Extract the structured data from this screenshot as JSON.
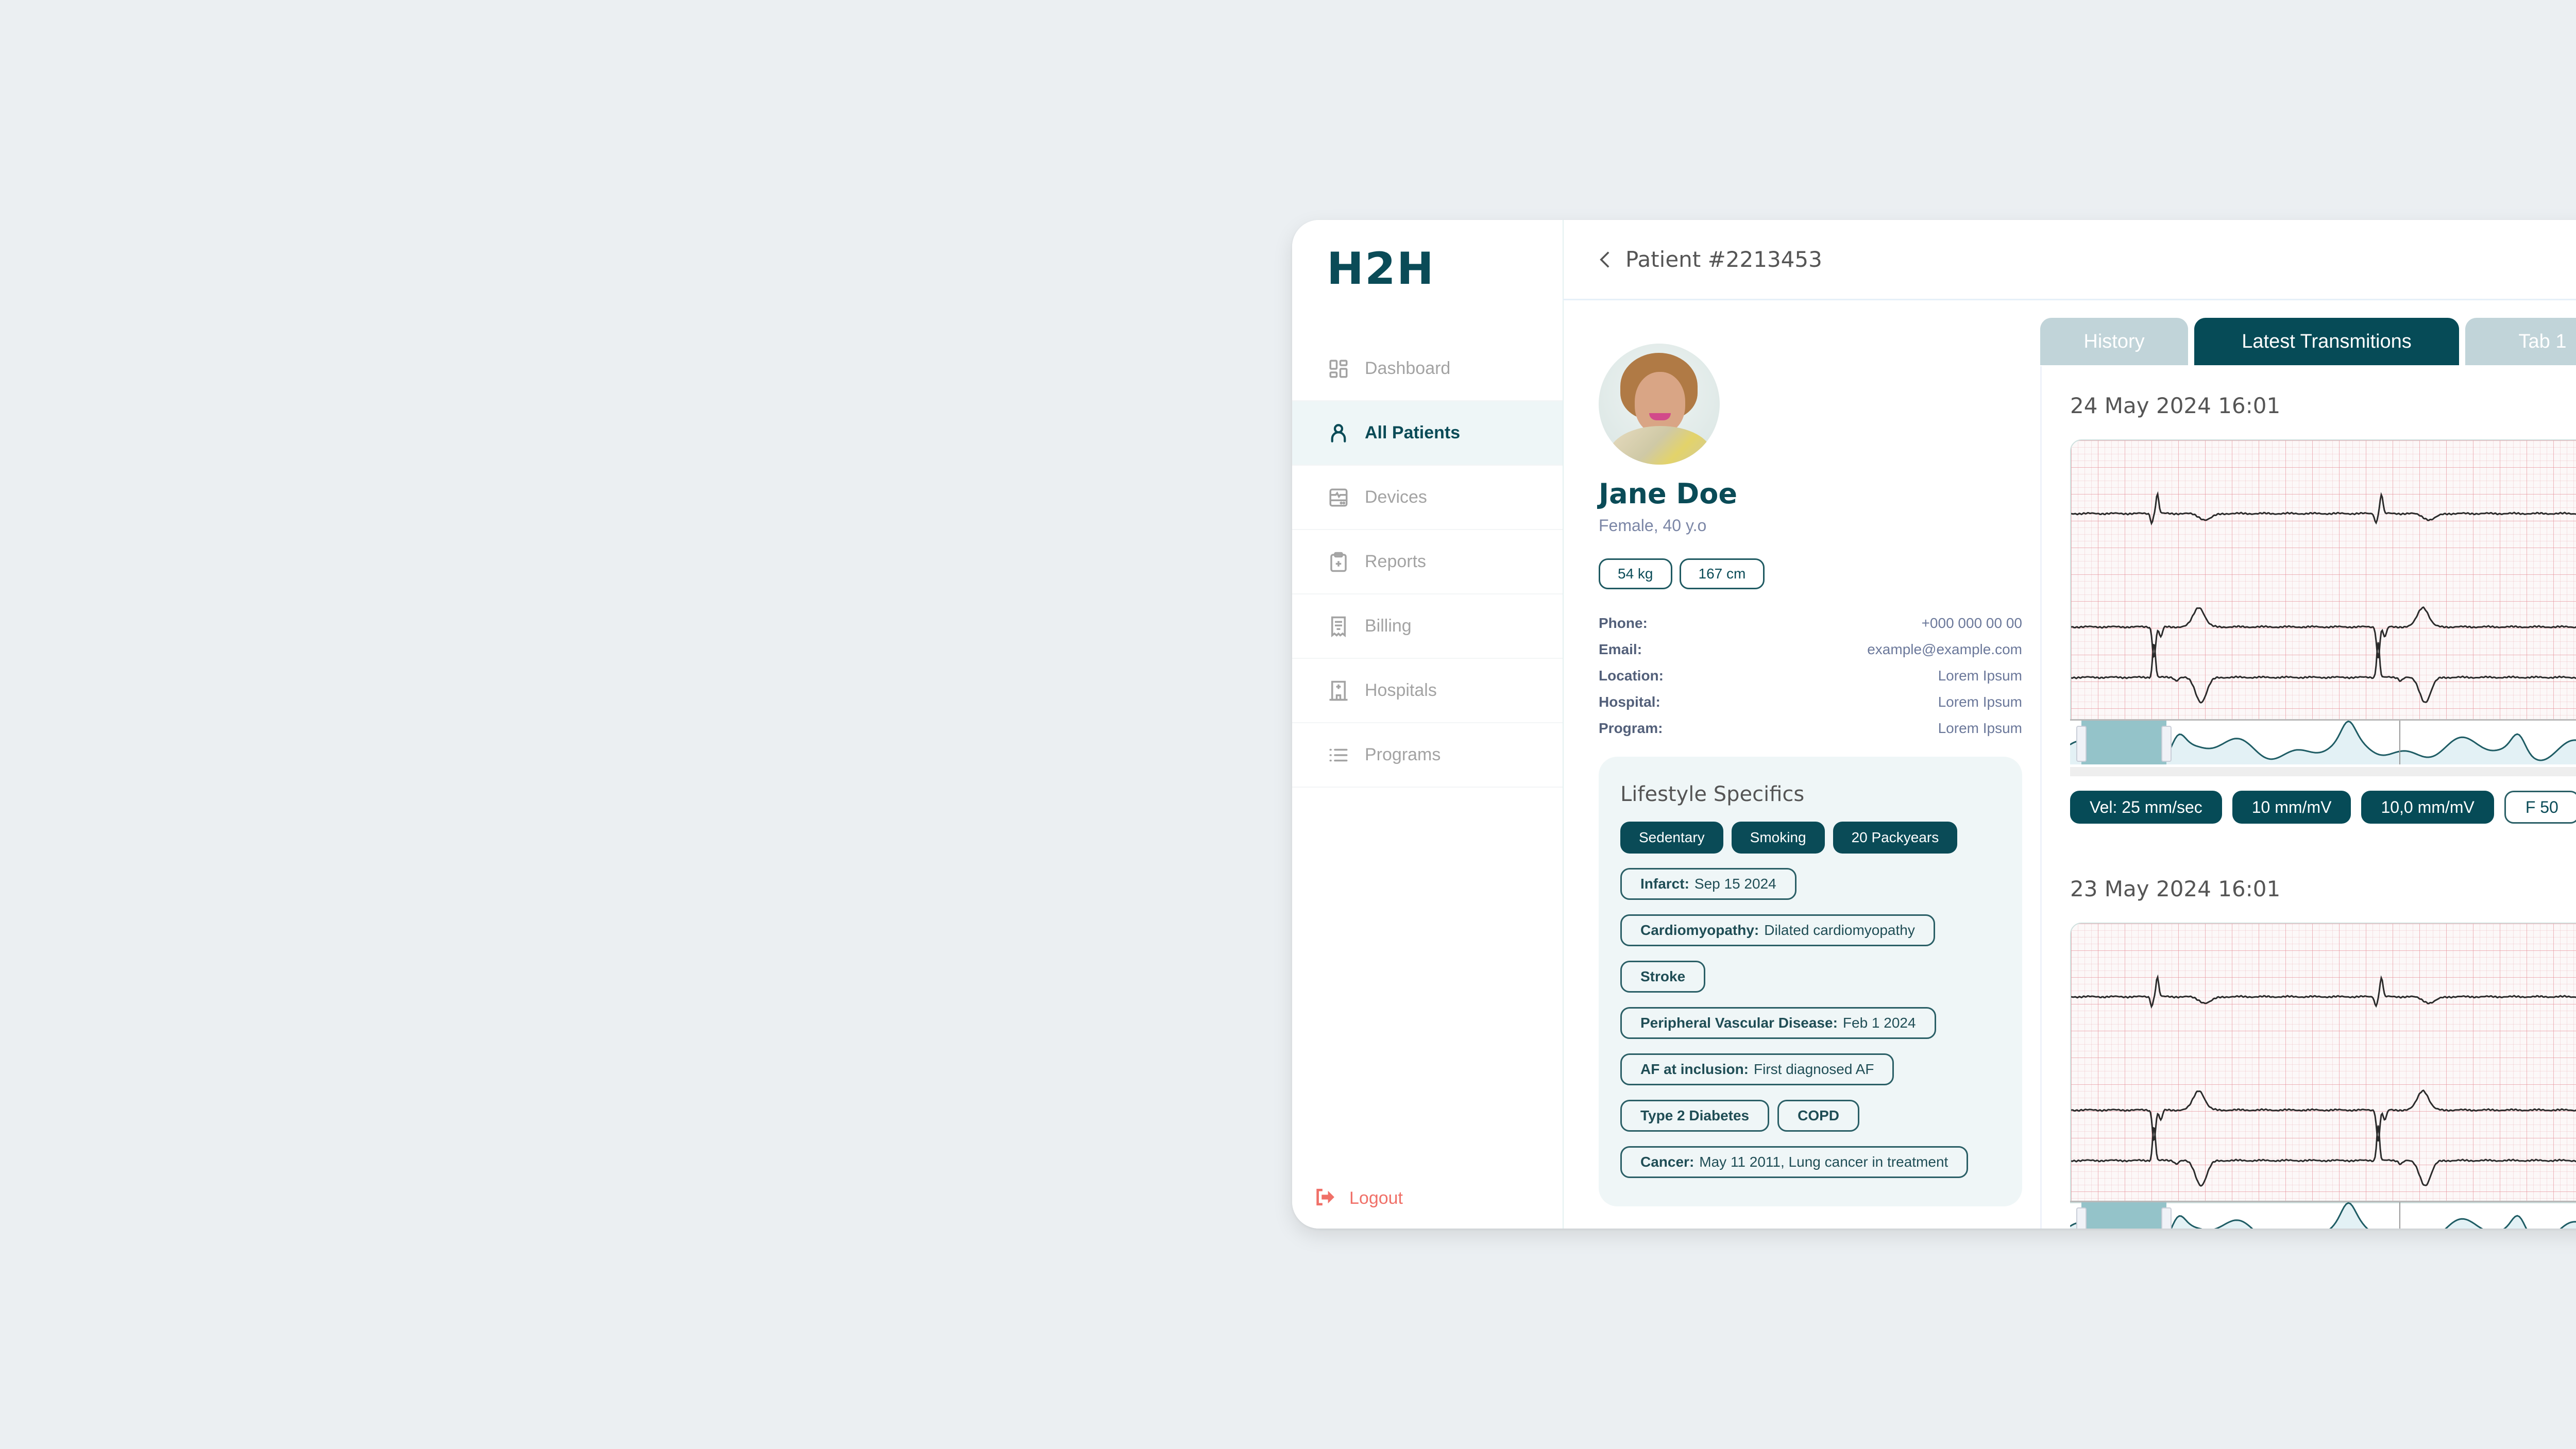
{
  "app": {
    "logo": "H2H"
  },
  "sidebar": {
    "items": [
      {
        "label": "Dashboard",
        "icon": "dashboard-icon",
        "active": false
      },
      {
        "label": "All Patients",
        "icon": "user-icon",
        "active": true
      },
      {
        "label": "Devices",
        "icon": "device-monitor-icon",
        "active": false
      },
      {
        "label": "Reports",
        "icon": "clipboard-plus-icon",
        "active": false
      },
      {
        "label": "Billing",
        "icon": "receipt-icon",
        "active": false
      },
      {
        "label": "Hospitals",
        "icon": "hospital-icon",
        "active": false
      },
      {
        "label": "Programs",
        "icon": "list-icon",
        "active": false
      }
    ],
    "logout_label": "Logout"
  },
  "header": {
    "title": "Patient #2213453"
  },
  "patient": {
    "name": "Jane Doe",
    "subtitle": "Female, 40 y.o",
    "weight": "54 kg",
    "height": "167 cm",
    "info": [
      {
        "key": "Phone:",
        "value": "+000 000 00 00"
      },
      {
        "key": "Email:",
        "value": "example@example.com"
      },
      {
        "key": "Location:",
        "value": "Lorem Ipsum"
      },
      {
        "key": "Hospital:",
        "value": "Lorem Ipsum"
      },
      {
        "key": "Program:",
        "value": "Lorem Ipsum"
      }
    ]
  },
  "lifestyle": {
    "title": "Lifestyle Specifics",
    "filled_tags": [
      "Sedentary",
      "Smoking",
      "20 Packyears"
    ],
    "conditions": [
      {
        "key": "Infarct:",
        "value": "Sep 15 2024"
      },
      {
        "key": "Cardiomyopathy:",
        "value": "Dilated cardiomyopathy"
      },
      {
        "key": "Stroke",
        "value": ""
      },
      {
        "key": "Peripheral Vascular Disease:",
        "value": "Feb 1 2024"
      },
      {
        "key": "AF at inclusion:",
        "value": "First diagnosed AF"
      },
      {
        "key": "Type 2 Diabetes",
        "value": ""
      },
      {
        "key": "COPD",
        "value": ""
      },
      {
        "key": "Cancer:",
        "value": "May 11 2011, Lung cancer in treatment"
      }
    ]
  },
  "tabs": [
    {
      "label": "History",
      "active": false
    },
    {
      "label": "Latest Transmitions",
      "active": true
    },
    {
      "label": "Tab 1",
      "active": false
    }
  ],
  "recordings": [
    {
      "date": "24 May 2024 16:01",
      "settings": [
        {
          "label": "Vel:  25 mm/sec",
          "style": "filled"
        },
        {
          "label": "10 mm/mV",
          "style": "filled"
        },
        {
          "label": "10,0 mm/mV",
          "style": "filled"
        },
        {
          "label": "F 50",
          "style": "outline"
        }
      ]
    },
    {
      "date": "23 May 2024 16:01"
    }
  ],
  "colors": {
    "brand": "#0a4b57",
    "active_tab": "#064b57",
    "inactive_tab": "#c1d4d9",
    "logout": "#f07068",
    "active_nav_bg": "#eef6f7",
    "lifestyle_bg": "#eff6f7",
    "page_bg": "#ebeff2"
  }
}
